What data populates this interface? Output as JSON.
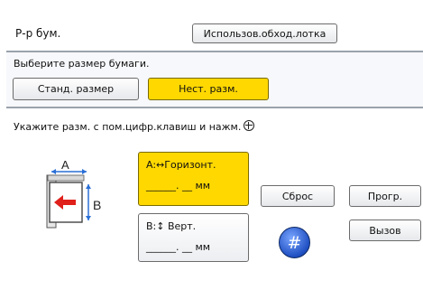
{
  "header": {
    "title": "Р-р бум.",
    "bypass_tray_button": "Использов.обход.лотка"
  },
  "paper_size": {
    "prompt": "Выберите размер бумаги.",
    "standard_button": "Станд. размер",
    "custom_button": "Нест. разм."
  },
  "custom": {
    "prompt": "Укажите разм. с пом.цифр.клавиш и нажм.",
    "field_a": {
      "label": "A:↔Горизонт.",
      "value": "______. __ мм"
    },
    "field_b": {
      "label": "B:↕ Верт.",
      "value": "______. __ мм"
    },
    "reset_button": "Сброс",
    "program_button": "Прогр.",
    "recall_button": "Вызов",
    "hash_button": "#"
  },
  "diagram": {
    "label_a": "A",
    "label_b": "B"
  },
  "colors": {
    "selected": "#ffd800",
    "hash": "#1f4fc2",
    "arrow": "#e0201b"
  }
}
